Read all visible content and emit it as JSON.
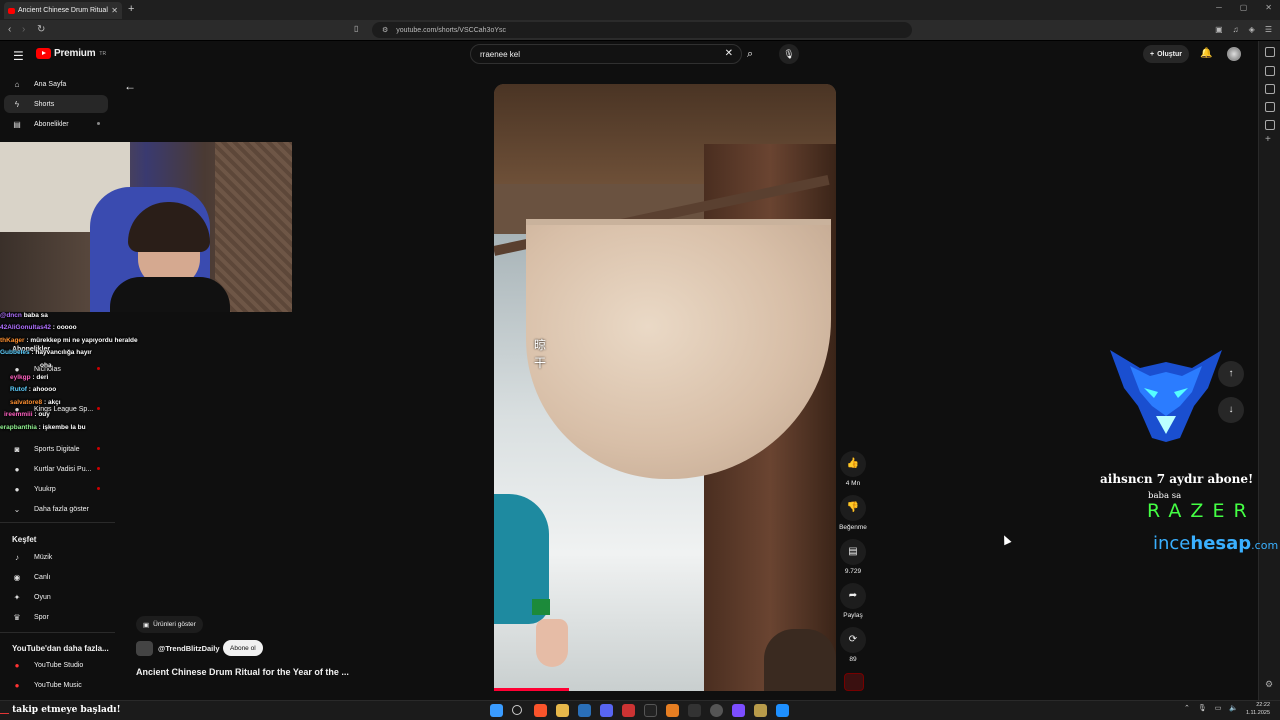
{
  "browser": {
    "tab_title": "Ancient Chinese Drum Ritual",
    "url": "youtube.com/shorts/VSCCah3oYsc"
  },
  "header": {
    "logo_text": "Premium",
    "logo_sup": "TR",
    "search_value": "rraenee kel",
    "create_label": "Oluştur"
  },
  "sidebar": {
    "items": [
      {
        "label": "Ana Sayfa",
        "icon": "home-icon"
      },
      {
        "label": "Shorts",
        "icon": "shorts-icon"
      },
      {
        "label": "Abonelikler",
        "icon": "subscriptions-icon"
      }
    ],
    "subs_title": "Abonelikler",
    "subs": [
      {
        "label": "Nicholas"
      },
      {
        "label": "Kings League Sp..."
      },
      {
        "label": "Sports Digitale"
      },
      {
        "label": "Kurtlar Vadisi Pu..."
      },
      {
        "label": "Yuukrp"
      }
    ],
    "more_label": "Daha fazla göster",
    "explore_title": "Keşfet",
    "explore": [
      {
        "label": "Müzik",
        "icon": "music-icon"
      },
      {
        "label": "Canlı",
        "icon": "live-icon"
      },
      {
        "label": "Oyun",
        "icon": "gaming-icon"
      },
      {
        "label": "Spor",
        "icon": "trophy-icon"
      }
    ],
    "more_yt_title": "YouTube'dan daha fazla...",
    "more_yt": [
      {
        "label": "YouTube Studio"
      },
      {
        "label": "YouTube Music"
      }
    ]
  },
  "chat": [
    {
      "user": "@dncn",
      "msg": "baba sa"
    },
    {
      "user": "42AliGonultas42",
      "msg": ": ooooo"
    },
    {
      "user": "thKager",
      "msg": ": mürekkep mi ne yapıyordu heralde"
    },
    {
      "user": "Abonelikler",
      "msg": ""
    },
    {
      "user": "Gubbeles",
      "msg": ": hayvancılığa hayır"
    },
    {
      "user": "",
      "msg": "oha"
    },
    {
      "user": "eylkgp",
      "msg": ": deri"
    },
    {
      "user": "Rutof",
      "msg": ": ahoooo"
    },
    {
      "user": "salvatore8",
      "msg": ": akçı"
    },
    {
      "user": "ireemmiii",
      "msg": ": ouy"
    },
    {
      "user": "erapbanthia",
      "msg": ": işkembe la bu"
    }
  ],
  "video": {
    "caption_chars": "晾干",
    "progress_fraction": 0.22,
    "products_label": "Ürünleri göster",
    "channel": "@TrendBlitzDaily",
    "subscribe_label": "Abone ol",
    "title": "Ancient Chinese Drum Ritual for the Year of the ..."
  },
  "actions": {
    "like_count": "4 Mn",
    "dislike_label": "Beğenme",
    "comment_count": "9.729",
    "share_label": "Paylaş",
    "remix_count": "89"
  },
  "overlay": {
    "alert_line1": "aihsncn 7 aydır abone!",
    "alert_line2": "baba sa",
    "sponsor1": "RAZER",
    "sponsor2_a": "ince",
    "sponsor2_b": "hesap",
    "sponsor2_c": ".com",
    "follow_user": "__",
    "follow_text": "takip etmeye başladı!"
  },
  "system": {
    "time": "22:22",
    "date": "1.11.2025"
  },
  "colors": {
    "yt_red": "#ff0000",
    "razer_green": "#44ff44",
    "ince_blue": "#3ab0ff"
  }
}
